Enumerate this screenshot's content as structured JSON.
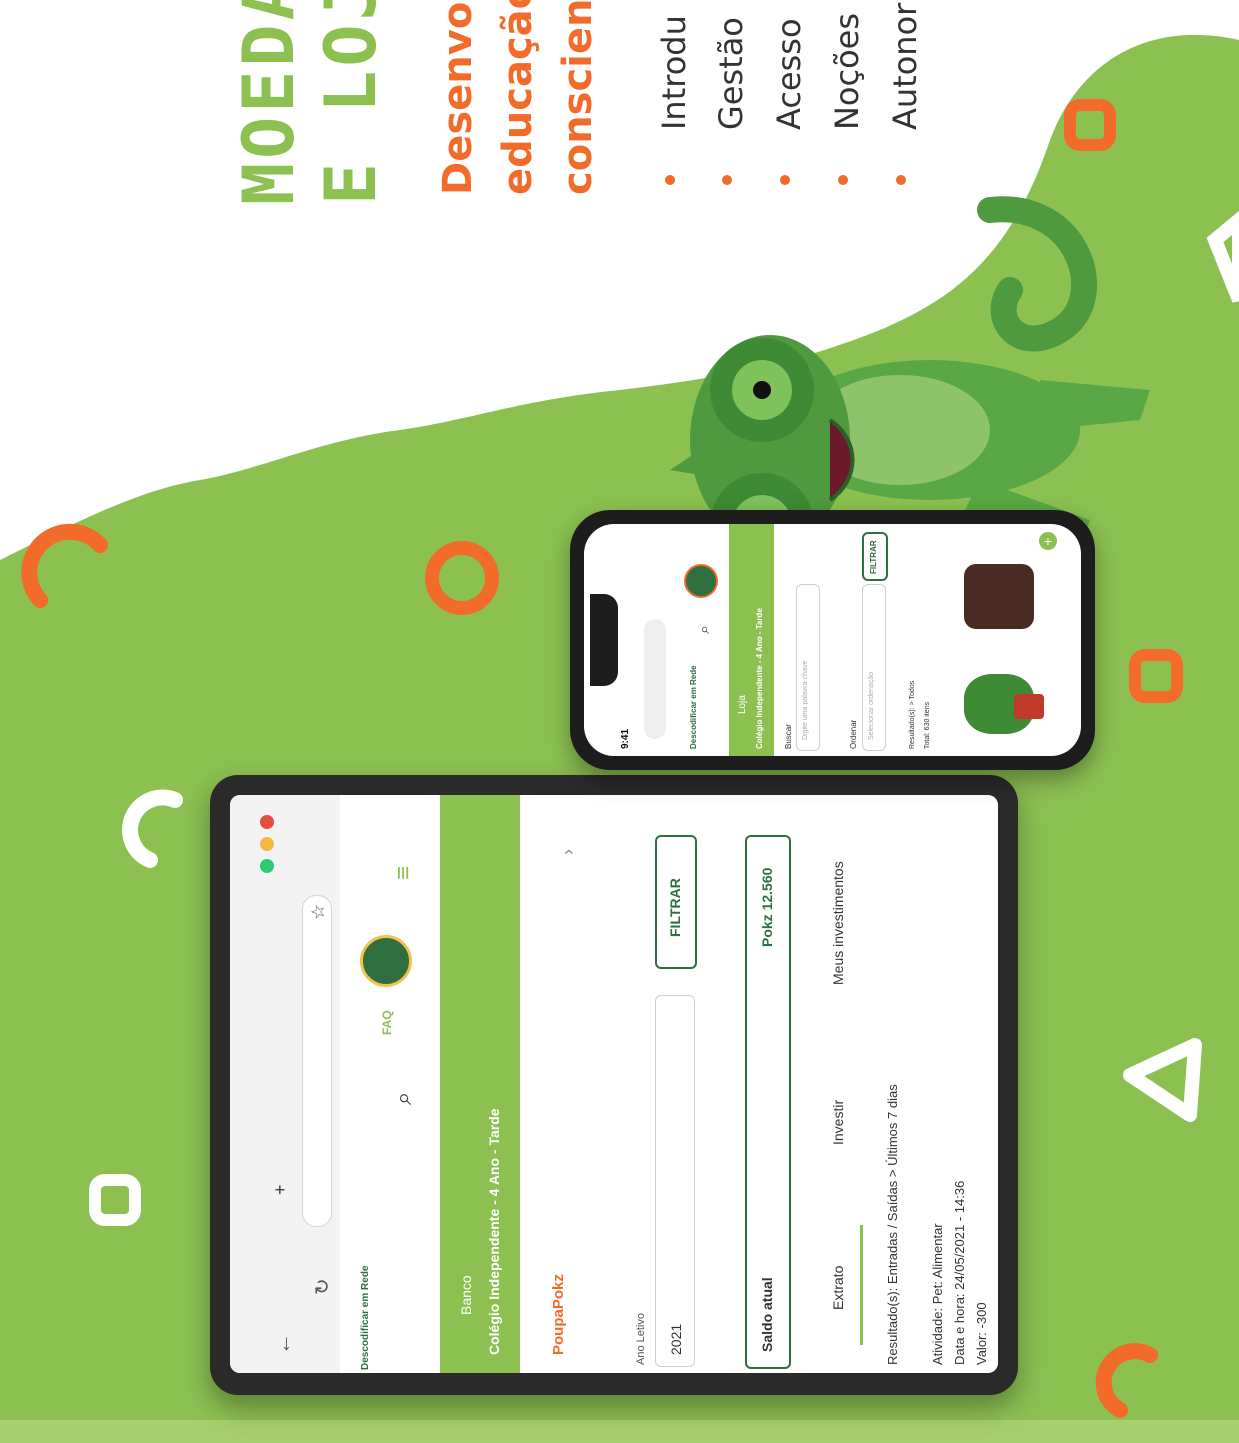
{
  "headline": {
    "line1": "MOEDA",
    "line2": "E LOJA",
    "subtitle_line1": "Desenvol",
    "subtitle_line2": "educação",
    "subtitle_line3": "conscien",
    "bullets": [
      "Introdu",
      "Gestão",
      "Acesso",
      "Noções",
      "Autonor"
    ]
  },
  "tablet": {
    "app_name": "Descodificar em Rede",
    "section": "Banco",
    "class_name": "Colégio Independente - 4 Ano - Tarde",
    "tab_poupapokz": "PoupaPokz",
    "ano_letivo_label": "Ano Letivo",
    "ano_letivo_value": "2021",
    "filter_button": "FILTRAR",
    "saldo_label": "Saldo atual",
    "saldo_value": "Pokz 12.560",
    "tabs": [
      "Extrato",
      "Investir",
      "Meus investimentos"
    ],
    "results_text": "Resultado(s): Entradas / Saídas > Últimos 7 dias",
    "atividade": "Atividade: Pet: Alimentar",
    "data_hora": "Data e hora: 24/05/2021 - 14:36",
    "valor": "Valor: -300",
    "faq": "FAQ"
  },
  "phone": {
    "time": "9:41",
    "app_name": "Descodificar em Rede",
    "section": "Loja",
    "class_name": "Colégio Independente - 4 Ano - Tarde",
    "buscar_label": "Buscar",
    "buscar_placeholder": "Digite uma palavra-chave",
    "ordenar_label": "Ordenar",
    "ordenar_placeholder": "Selecionar ordenação",
    "filter_button": "FILTRAR",
    "resultados": "Resultado(s): > Todos",
    "total": "Total: 630 itens"
  },
  "colors": {
    "green": "#8cc152",
    "dark_green": "#2f6f3f",
    "orange": "#f26b2a"
  }
}
